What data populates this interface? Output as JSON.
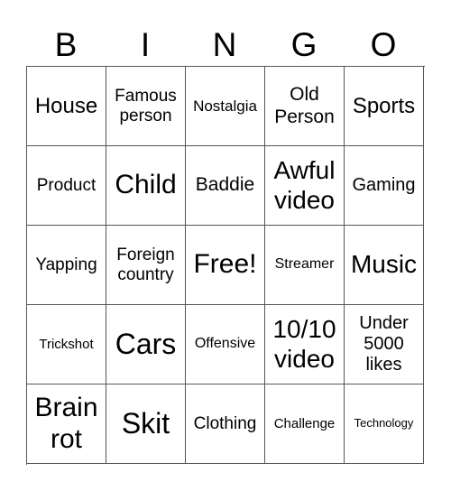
{
  "header": [
    "B",
    "I",
    "N",
    "G",
    "O"
  ],
  "cells": [
    [
      "House",
      "Famous person",
      "Nostalgia",
      "Old Person",
      "Sports"
    ],
    [
      "Product",
      "Child",
      "Baddie",
      "Awful video",
      "Gaming"
    ],
    [
      "Yapping",
      "Foreign country",
      "Free!",
      "Streamer",
      "Music"
    ],
    [
      "Trickshot",
      "Cars",
      "Offensive",
      "10/10 video",
      "Under 5000 likes"
    ],
    [
      "Brain rot",
      "Skit",
      "Clothing",
      "Challenge",
      "Technology"
    ]
  ]
}
